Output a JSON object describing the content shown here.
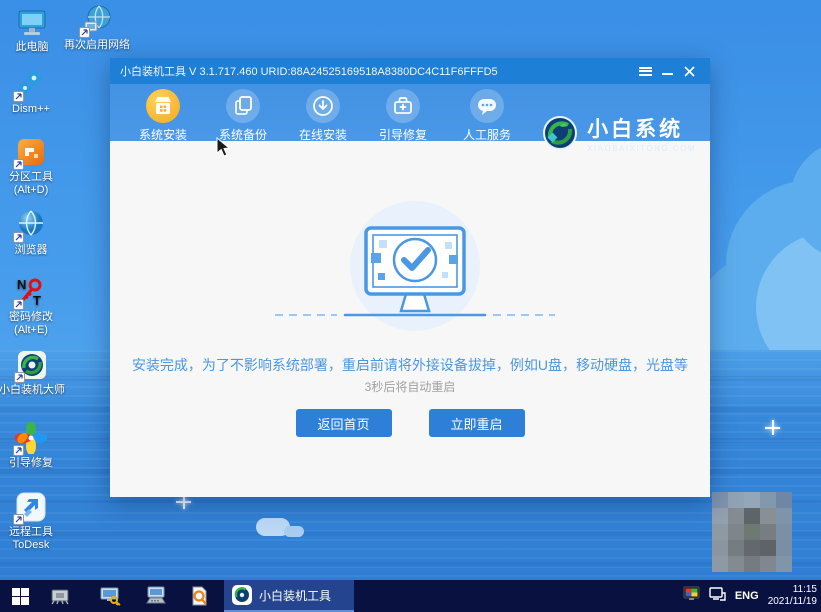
{
  "window": {
    "title": "小白装机工具 V 3.1.717.460 URID:88A24525169518A8380DC4C11F6FFFD5",
    "nav": [
      {
        "label": "系统安装",
        "active": true
      },
      {
        "label": "系统备份",
        "active": false
      },
      {
        "label": "在线安装",
        "active": false
      },
      {
        "label": "引导修复",
        "active": false
      },
      {
        "label": "人工服务",
        "active": false
      }
    ],
    "brand": {
      "name": "小白系统",
      "domain": "XIAOBAIXITONG.COM"
    },
    "main": {
      "message": "安装完成，为了不影响系统部署，重启前请将外接设备拔掉，例如U盘，移动硬盘，光盘等",
      "countdown": "3秒后将自动重启",
      "home_button": "返回首页",
      "restart_button": "立即重启"
    }
  },
  "desktop": {
    "icons": [
      {
        "id": "this-pc",
        "label": "此电脑"
      },
      {
        "id": "re-enable-network",
        "label": "再次启用网络"
      },
      {
        "id": "dism",
        "label": "Dism++"
      },
      {
        "id": "partition-tool",
        "label": "分区工具",
        "sublabel": "(Alt+D)"
      },
      {
        "id": "browser",
        "label": "浏览器"
      },
      {
        "id": "password-reset",
        "label": "密码修改",
        "sublabel": "(Alt+E)"
      },
      {
        "id": "xiaobai-master",
        "label": "小白装机大师"
      },
      {
        "id": "boot-repair",
        "label": "引导修复"
      },
      {
        "id": "todesk",
        "label": "远程工具",
        "sublabel": "ToDesk"
      }
    ]
  },
  "taskbar": {
    "active_app": "小白装机工具",
    "tray": {
      "lang": "ENG",
      "time": "11:15",
      "date": "2021/11/19"
    }
  },
  "colors": {
    "titlebar": "#1e7fd6",
    "header": "#4392e3",
    "accent_blue": "#2d7fd8",
    "active_nav": "#f5b32f",
    "message_blue": "#4a97e4",
    "taskbar": "#081140",
    "desktop_sky": "#3a8fe6",
    "desktop_sea": "#3688da"
  },
  "mosaic": {
    "cells": [
      [
        "#7f93ad",
        "#8fa3b5",
        "#93a7b9",
        "#8398ac",
        "#6f87a5"
      ],
      [
        "#93a0ae",
        "#848b93",
        "#5e6468",
        "#888f95",
        "#7e94ab"
      ],
      [
        "#8d99a3",
        "#7e858b",
        "#6d7a74",
        "#767d83",
        "#7b90a6"
      ],
      [
        "#8a95a0",
        "#757c82",
        "#62686c",
        "#5d6367",
        "#7a8fa5"
      ],
      [
        "#8d9aa6",
        "#838a90",
        "#757b80",
        "#808790",
        "#8095aa"
      ]
    ]
  }
}
